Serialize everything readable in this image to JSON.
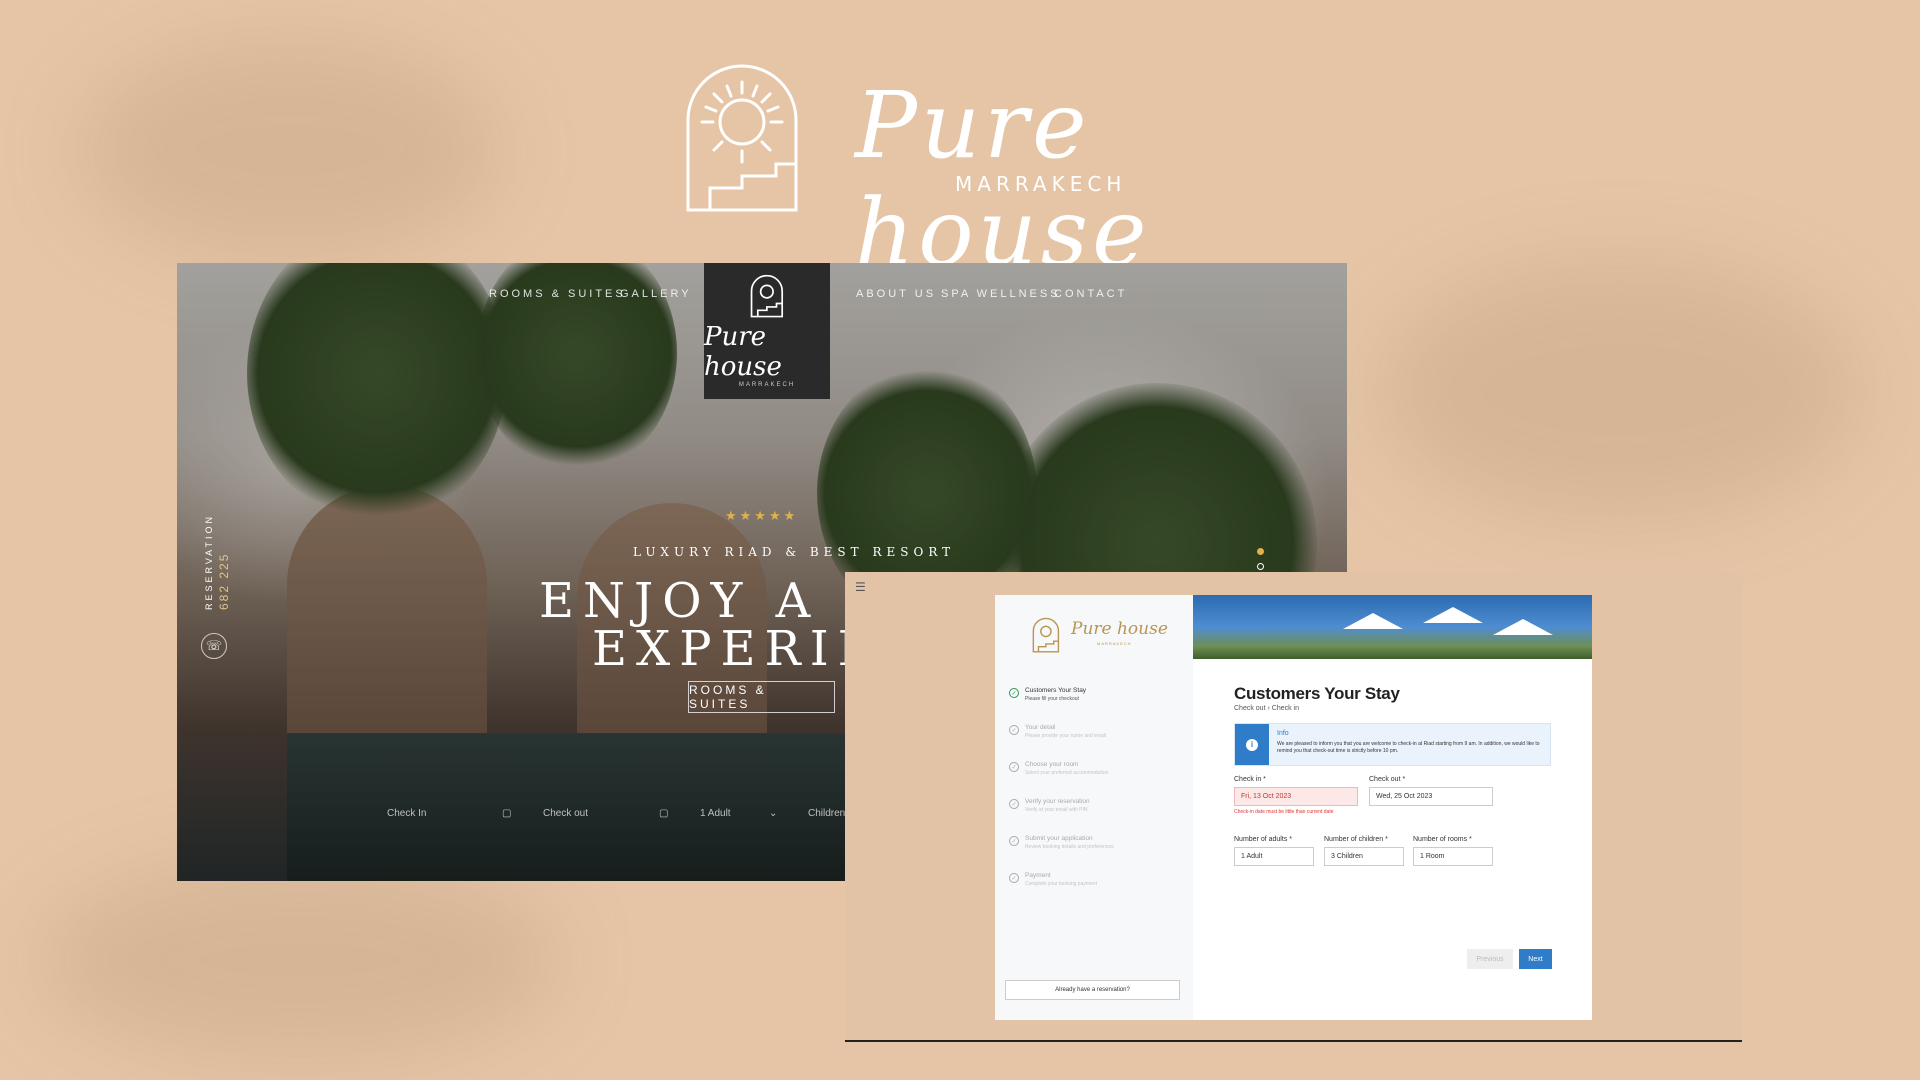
{
  "brand": {
    "name": "Pure house",
    "city": "MARRAKECH"
  },
  "website": {
    "nav_left": [
      "ROOMS & SUITES",
      "GALLERY"
    ],
    "nav_right": [
      "ABOUT US",
      "SPA WELLNESS",
      "CONTACT"
    ],
    "logo_name": "Pure house",
    "logo_city": "MARRAKECH",
    "stars": "★★★★★",
    "tagline": "LUXURY RIAD & BEST RESORT",
    "headline_1": "ENJOY A LU",
    "headline_2": "EXPERIEN",
    "cta": "ROOMS & SUITES",
    "reservation_label": "RESERVATION",
    "reservation_phone": "682 225",
    "booking": {
      "checkin": "Check In",
      "checkout": "Check out",
      "adults": "1 Adult",
      "children": "Children"
    }
  },
  "booking_app": {
    "logo_name": "Pure house",
    "logo_city": "MARRAKECH",
    "steps": [
      {
        "title": "Customers Your Stay",
        "subtitle": "Please fill your checkout",
        "done": true
      },
      {
        "title": "Your detail",
        "subtitle": "Please provide your name and email",
        "done": false
      },
      {
        "title": "Choose your room",
        "subtitle": "Select your preferred accommodation",
        "done": false
      },
      {
        "title": "Verify your reservation",
        "subtitle": "Verify at your email with PIN",
        "done": false
      },
      {
        "title": "Submit your application",
        "subtitle": "Review booking details and preferences",
        "done": false
      },
      {
        "title": "Payment",
        "subtitle": "Complete your booking payment",
        "done": false
      }
    ],
    "already_reservation": "Already have a reservation?",
    "title": "Customers Your Stay",
    "breadcrumb": [
      "Check out",
      "Check in"
    ],
    "info": {
      "title": "Info",
      "text": "We are pleased to inform you that you are welcome to check-in at Riad starting from 9 am. In addition, we would like to remind you that check-out time is strictly before 10 pm."
    },
    "fields": {
      "checkin_label": "Check in *",
      "checkin_value": "Fri, 13 Oct 2023",
      "checkin_error": "Check-in date must be little than current date",
      "checkout_label": "Check out *",
      "checkout_value": "Wed, 25 Oct 2023",
      "adults_label": "Number of adults *",
      "adults_value": "1 Adult",
      "children_label": "Number of children *",
      "children_value": "3 Children",
      "rooms_label": "Number of rooms *",
      "rooms_value": "1 Room"
    },
    "previous_label": "Previous",
    "next_label": "Next"
  },
  "colors": {
    "background": "#e5c5a6",
    "accent_blue": "#2f7cc8",
    "gold": "#e2b24a"
  }
}
